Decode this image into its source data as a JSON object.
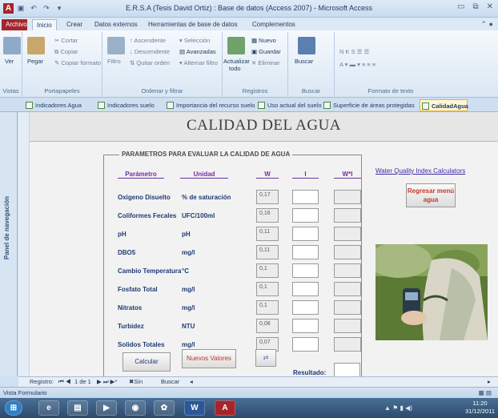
{
  "window": {
    "title": "E.R.S.A (Tesis David Ortiz) : Base de datos (Access 2007) - Microsoft Access"
  },
  "ribbon_tabs": [
    "Archivo",
    "Inicio",
    "Crear",
    "Datos externos",
    "Herramientas de base de datos",
    "Complementos"
  ],
  "ribbon": {
    "vistas": {
      "ver": "Ver",
      "label": "Vistas"
    },
    "portapapeles": {
      "pegar": "Pegar",
      "cortar": "Cortar",
      "copiar": "Copiar",
      "copiar_formato": "Copiar formato",
      "label": "Portapapeles"
    },
    "ordenar": {
      "filtro": "Filtro",
      "ascendente": "Ascendente",
      "descendente": "Descendente",
      "quitar_orden": "Quitar orden",
      "seleccion": "Selección",
      "avanzadas": "Avanzadas",
      "alternar_filtro": "Alternar filtro",
      "label": "Ordenar y filtrar"
    },
    "registros": {
      "actualizar": "Actualizar",
      "todo": "todo",
      "nuevo": "Nuevo",
      "guardar": "Guardar",
      "eliminar": "Eliminar",
      "label": "Registros"
    },
    "buscar": {
      "buscar": "Buscar",
      "label": "Buscar"
    },
    "formato": {
      "label": "Formato de texto"
    }
  },
  "object_tabs": [
    "Indicadores Agua",
    "Indicadores suelo",
    "Importancia del recurso suelo",
    "Uso actual del suelo",
    "Superficie de áreas protegidas",
    "CalidadAgua"
  ],
  "nav_pane": {
    "label": "Panel de navegación"
  },
  "form": {
    "title": "CALIDAD DEL AGUA",
    "group_label": "PARAMETROS PARA EVALUAR LA CALIDAD DE AGUA",
    "headers": {
      "param": "Parámetro",
      "unit": "Unidad",
      "w": "W",
      "i": "I",
      "wi": "W*I"
    },
    "rows": [
      {
        "param": "Oxigeno Disuelto",
        "unit": "% de saturación",
        "w": "0,17"
      },
      {
        "param": "Coliformes Fecales",
        "unit": "UFC/100ml",
        "w": "0,16"
      },
      {
        "param": "pH",
        "unit": "pH",
        "w": "0,11"
      },
      {
        "param": "DBO5",
        "unit": "mg/l",
        "w": "0,11"
      },
      {
        "param": "Cambio Temperatura",
        "unit": "°C",
        "w": "0,1"
      },
      {
        "param": "Fosfato Total",
        "unit": "mg/l",
        "w": "0,1"
      },
      {
        "param": "Nitratos",
        "unit": "mg/l",
        "w": "0,1"
      },
      {
        "param": "Turbidez",
        "unit": "NTU",
        "w": "0,08"
      },
      {
        "param": "Solidos Totales",
        "unit": "mg/l",
        "w": "0,07"
      }
    ],
    "calcular": "Calcular",
    "nuevos_valores": "Nuevos Valores",
    "resultado": "Resultado:",
    "link": "Water Quality Index Calculators",
    "regresar": "Regresar menú agua"
  },
  "record_nav": {
    "registro": "Registro:",
    "position": "1 de 1",
    "filter": "Sin filtro",
    "buscar": "Buscar"
  },
  "status": {
    "text": "Vista Formulario"
  },
  "clock": {
    "time": "11:20",
    "date": "31/12/2011"
  },
  "colors": {
    "accent": "#a4262c",
    "header_purple": "#7030a0",
    "label_blue": "#1f3b73"
  }
}
